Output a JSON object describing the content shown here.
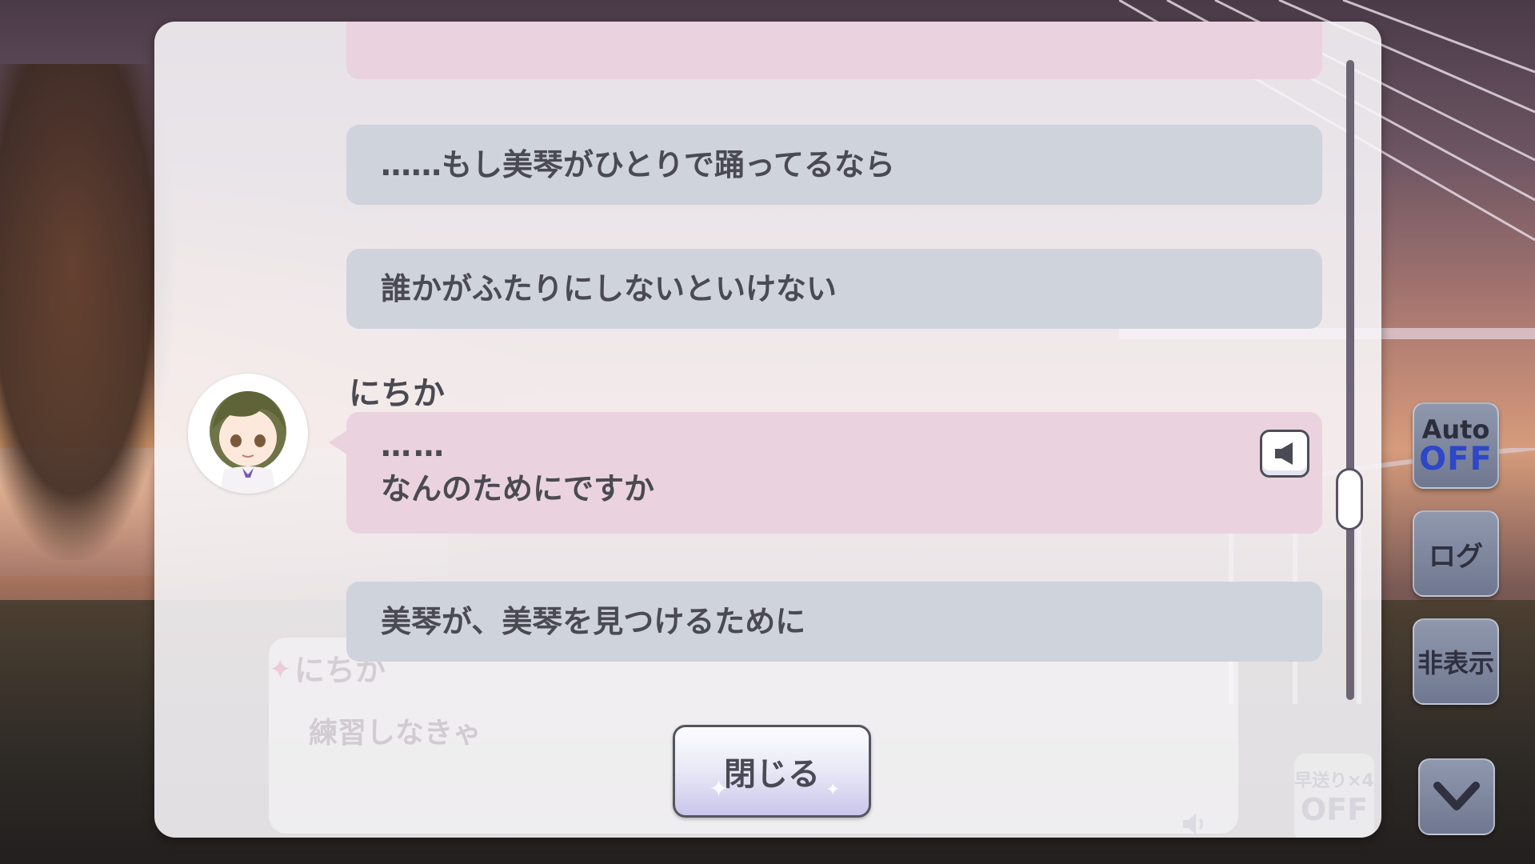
{
  "log": {
    "messages": [
      {
        "speaker": "",
        "text": "……もし美琴がひとりで踊ってるなら"
      },
      {
        "speaker": "",
        "text": "誰かがふたりにしないといけない"
      },
      {
        "speaker": "にちか",
        "line1": "……",
        "line2": "なんのためにですか"
      },
      {
        "speaker": "",
        "text": "美琴が、美琴を見つけるために"
      }
    ],
    "close_label": "閉じる"
  },
  "underlying_dialog": {
    "name": "にちか",
    "text": "練習しなきゃ",
    "fast_forward_label": "早送り×4",
    "fast_forward_state": "OFF"
  },
  "side_controls": {
    "auto_label": "Auto",
    "auto_state": "OFF",
    "log_label": "ログ",
    "hide_label": "非表示"
  },
  "colors": {
    "bubble_gray": "#cfd3db",
    "bubble_pink": "#ead3de",
    "auto_state": "#2e47c7"
  },
  "icons": {
    "voice_replay": "speaker-icon",
    "scroll_down": "chevron-down-icon"
  }
}
